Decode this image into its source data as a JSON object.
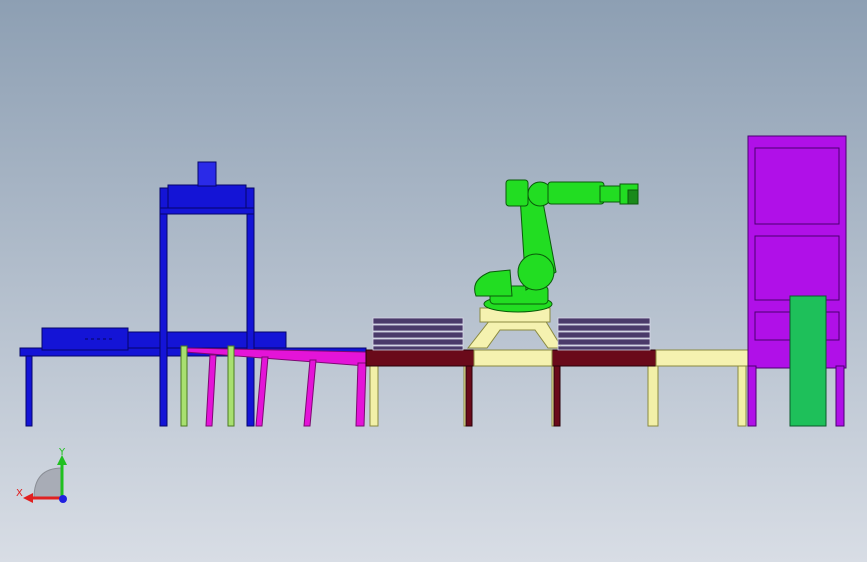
{
  "viewport": {
    "background_top": "#8d9fb3",
    "background_bottom": "#d8dde5"
  },
  "model": {
    "components": [
      {
        "name": "infeed-conveyor",
        "color": "#1414d6"
      },
      {
        "name": "gantry-frame",
        "color": "#1414d6"
      },
      {
        "name": "press-cylinder",
        "color": "#2a2ae8"
      },
      {
        "name": "inclined-conveyor",
        "color": "#e414d8"
      },
      {
        "name": "support-legs",
        "color": "#a8e070"
      },
      {
        "name": "roller-conveyor",
        "color": "#6a0a1a"
      },
      {
        "name": "conveyor-legs",
        "color": "#f2f0a8"
      },
      {
        "name": "robot-base-frame",
        "color": "#f5f2b0"
      },
      {
        "name": "robot-arm",
        "color": "#22dd22"
      },
      {
        "name": "pallet-stack",
        "color": "#4a3a6a"
      },
      {
        "name": "pallet-magazine",
        "color": "#b010e8"
      },
      {
        "name": "guard-door",
        "color": "#1ec05a"
      }
    ]
  },
  "triad": {
    "x_label": "X",
    "y_label": "Y",
    "x_color": "#e02020",
    "y_color": "#20c020",
    "z_color": "#2020e0"
  }
}
